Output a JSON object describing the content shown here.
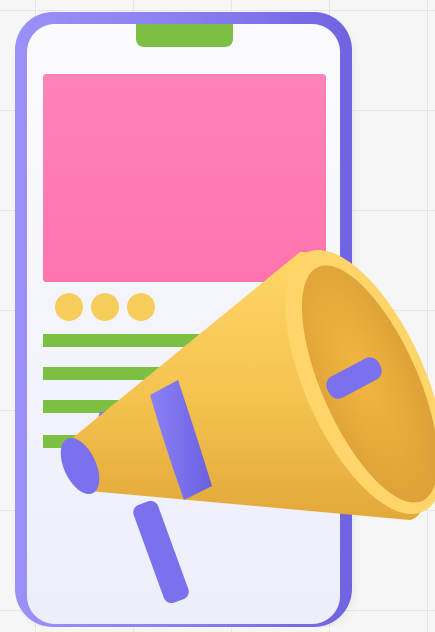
{
  "illustration": {
    "subject": "megaphone",
    "device": "smartphone"
  },
  "colors": {
    "background": "#f6f6f6",
    "grid_lines": "#e6e6e6",
    "phone_frame": "#8a7ff0",
    "phone_screen": "#f4f5fb",
    "notch": "#7cc043",
    "banner": "#ff7fb5",
    "dots": "#f6cd5a",
    "text_lines": "#7cc043",
    "megaphone_body": "#f4c24f",
    "megaphone_band": "#7b70ee"
  },
  "screen_content": {
    "dot_count": 3,
    "text_line_count": 4
  }
}
